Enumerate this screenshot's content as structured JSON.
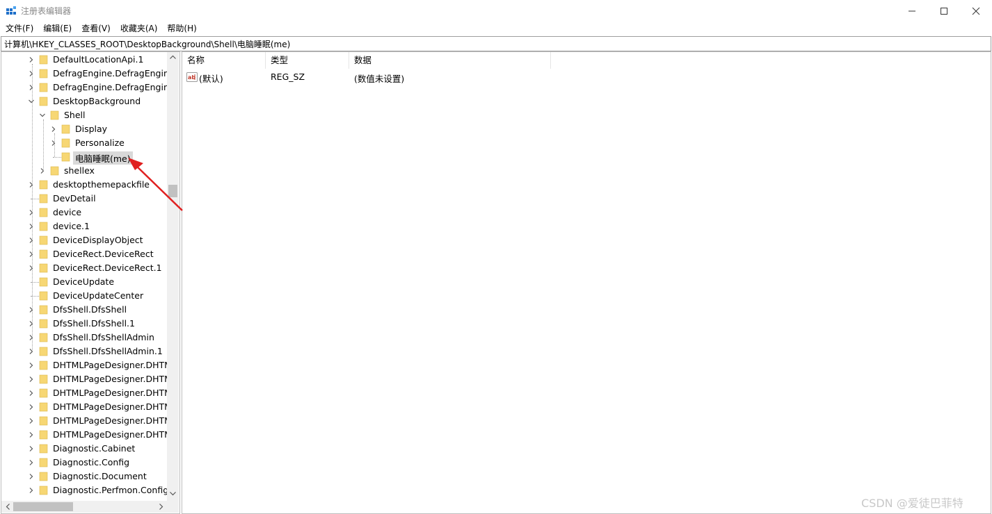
{
  "window": {
    "title": "注册表编辑器",
    "controls": {
      "minimize": "minimize-icon",
      "maximize": "maximize-icon",
      "close": "close-icon"
    }
  },
  "menu": [
    {
      "label": "文件(F)"
    },
    {
      "label": "编辑(E)"
    },
    {
      "label": "查看(V)"
    },
    {
      "label": "收藏夹(A)"
    },
    {
      "label": "帮助(H)"
    }
  ],
  "address": {
    "path": "计算机\\HKEY_CLASSES_ROOT\\DesktopBackground\\Shell\\电脑睡眠(me)"
  },
  "tree": {
    "items": [
      {
        "label": "DefaultLocationApi.1",
        "level": 0,
        "expander": "collapsed"
      },
      {
        "label": "DefragEngine.DefragEngine",
        "level": 0,
        "expander": "collapsed"
      },
      {
        "label": "DefragEngine.DefragEngine.",
        "level": 0,
        "expander": "collapsed"
      },
      {
        "label": "DesktopBackground",
        "level": 0,
        "expander": "expanded"
      },
      {
        "label": "Shell",
        "level": 1,
        "expander": "expanded"
      },
      {
        "label": "Display",
        "level": 2,
        "expander": "collapsed"
      },
      {
        "label": "Personalize",
        "level": 2,
        "expander": "collapsed"
      },
      {
        "label": "电脑睡眠(me)",
        "level": 2,
        "expander": "none",
        "selected": true
      },
      {
        "label": "shellex",
        "level": 1,
        "expander": "collapsed"
      },
      {
        "label": "desktopthemepackfile",
        "level": 0,
        "expander": "collapsed"
      },
      {
        "label": "DevDetail",
        "level": 0,
        "expander": "none"
      },
      {
        "label": "device",
        "level": 0,
        "expander": "collapsed"
      },
      {
        "label": "device.1",
        "level": 0,
        "expander": "collapsed"
      },
      {
        "label": "DeviceDisplayObject",
        "level": 0,
        "expander": "collapsed"
      },
      {
        "label": "DeviceRect.DeviceRect",
        "level": 0,
        "expander": "collapsed"
      },
      {
        "label": "DeviceRect.DeviceRect.1",
        "level": 0,
        "expander": "collapsed"
      },
      {
        "label": "DeviceUpdate",
        "level": 0,
        "expander": "none"
      },
      {
        "label": "DeviceUpdateCenter",
        "level": 0,
        "expander": "none"
      },
      {
        "label": "DfsShell.DfsShell",
        "level": 0,
        "expander": "collapsed"
      },
      {
        "label": "DfsShell.DfsShell.1",
        "level": 0,
        "expander": "collapsed"
      },
      {
        "label": "DfsShell.DfsShellAdmin",
        "level": 0,
        "expander": "collapsed"
      },
      {
        "label": "DfsShell.DfsShellAdmin.1",
        "level": 0,
        "expander": "collapsed"
      },
      {
        "label": "DHTMLPageDesigner.DHTM",
        "level": 0,
        "expander": "collapsed"
      },
      {
        "label": "DHTMLPageDesigner.DHTM",
        "level": 0,
        "expander": "collapsed"
      },
      {
        "label": "DHTMLPageDesigner.DHTM",
        "level": 0,
        "expander": "collapsed"
      },
      {
        "label": "DHTMLPageDesigner.DHTM",
        "level": 0,
        "expander": "collapsed"
      },
      {
        "label": "DHTMLPageDesigner.DHTM",
        "level": 0,
        "expander": "collapsed"
      },
      {
        "label": "DHTMLPageDesigner.DHTM",
        "level": 0,
        "expander": "collapsed"
      },
      {
        "label": "Diagnostic.Cabinet",
        "level": 0,
        "expander": "collapsed"
      },
      {
        "label": "Diagnostic.Config",
        "level": 0,
        "expander": "collapsed"
      },
      {
        "label": "Diagnostic.Document",
        "level": 0,
        "expander": "collapsed"
      },
      {
        "label": "Diagnostic.Perfmon.Config",
        "level": 0,
        "expander": "collapsed"
      }
    ]
  },
  "list": {
    "columns": [
      {
        "label": "名称"
      },
      {
        "label": "类型"
      },
      {
        "label": "数据"
      }
    ],
    "rows": [
      {
        "name": "(默认)",
        "type": "REG_SZ",
        "data": "(数值未设置)",
        "icon": "string-value-icon"
      }
    ]
  },
  "watermark": "CSDN @爱徒巴菲特",
  "colors": {
    "folder": "#f7d774",
    "selection": "#d9d9d9",
    "annotation_arrow": "#e02020"
  }
}
